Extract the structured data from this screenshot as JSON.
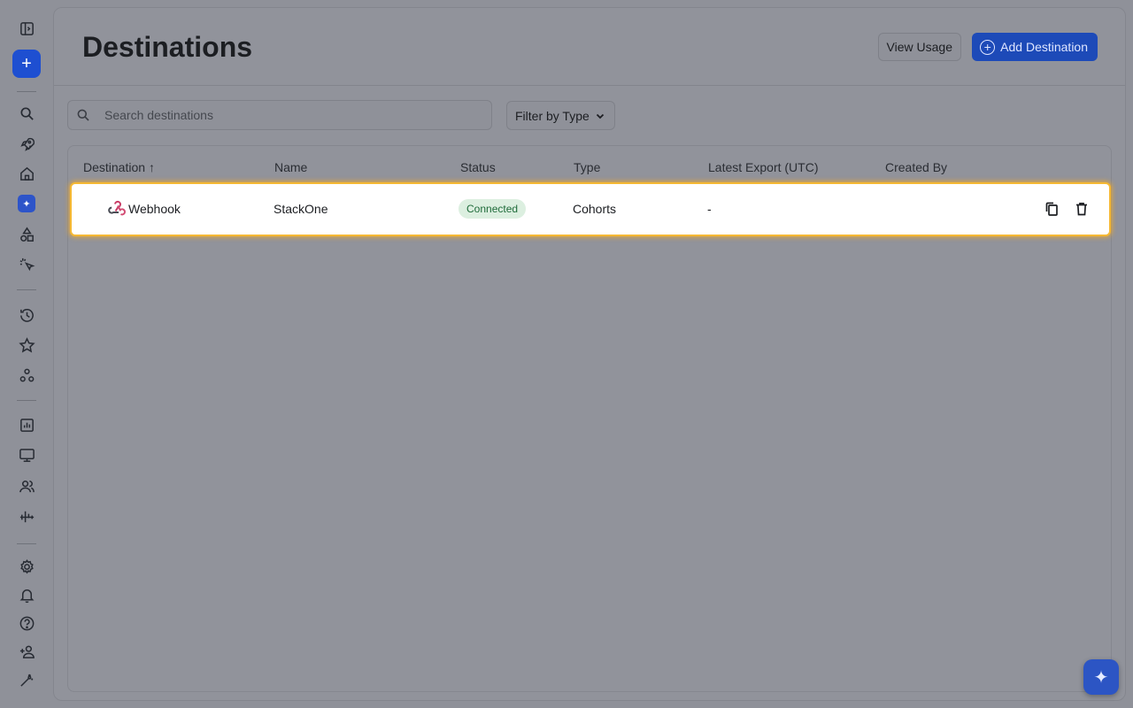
{
  "page": {
    "title": "Destinations"
  },
  "header": {
    "view_usage_label": "View Usage",
    "add_destination_label": "Add Destination"
  },
  "toolbar": {
    "search_placeholder": "Search destinations",
    "filter_label": "Filter by Type"
  },
  "table": {
    "columns": [
      "Destination",
      "Name",
      "Status",
      "Type",
      "Latest Export (UTC)",
      "Created By"
    ],
    "sort_indicator": "↑",
    "rows": [
      {
        "destination": "Webhook",
        "name": "StackOne",
        "status": "Connected",
        "type": "Cohorts",
        "latest_export": "-",
        "created_by": ""
      }
    ]
  },
  "colors": {
    "accent": "#1e4fd1",
    "highlight": "#f5b833",
    "status_green_bg": "#dcefe0",
    "status_green_text": "#1f6b3a"
  },
  "sidebar_icons": [
    "sidebar-toggle-icon",
    "plus-icon",
    "search-icon",
    "rocket-icon",
    "home-icon",
    "ai-sparkle-icon",
    "shapes-icon",
    "click-icon",
    "history-icon",
    "star-icon",
    "cohorts-icon",
    "chart-icon",
    "monitor-icon",
    "users-icon",
    "signal-icon",
    "gear-icon",
    "bell-icon",
    "help-icon",
    "add-user-icon",
    "wand-icon"
  ]
}
